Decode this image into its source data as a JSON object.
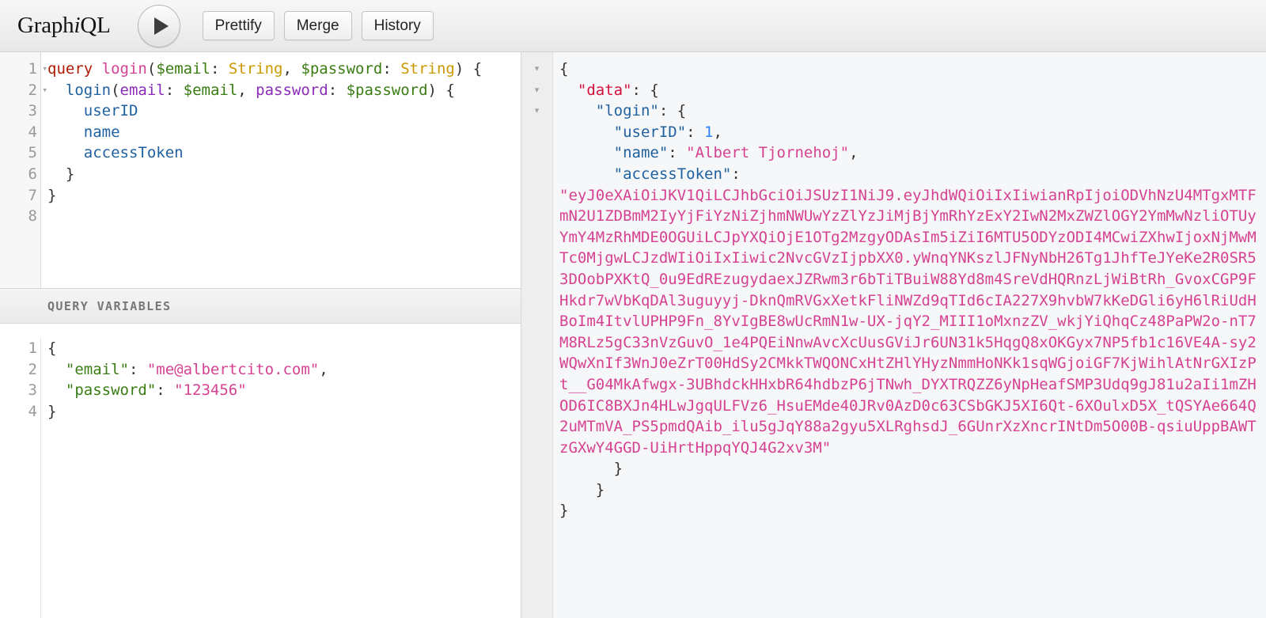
{
  "app": {
    "name": "GraphiQL",
    "name_prefix": "Graph",
    "name_italic": "i",
    "name_suffix": "QL"
  },
  "toolbar": {
    "execute_label": "▶",
    "execute_icon": "play-icon",
    "prettify_label": "Prettify",
    "merge_label": "Merge",
    "history_label": "History"
  },
  "query_editor": {
    "line_numbers": [
      "1",
      "2",
      "3",
      "4",
      "5",
      "6",
      "7",
      "8"
    ],
    "folds": [
      true,
      true,
      false,
      false,
      false,
      false,
      false,
      false
    ],
    "lines": [
      [
        {
          "text": "query",
          "type": "keyword"
        },
        {
          "text": " ",
          "type": "plain"
        },
        {
          "text": "login",
          "type": "def"
        },
        {
          "text": "(",
          "type": "punct"
        },
        {
          "text": "$email",
          "type": "variable"
        },
        {
          "text": ": ",
          "type": "punct"
        },
        {
          "text": "String",
          "type": "type"
        },
        {
          "text": ", ",
          "type": "punct"
        },
        {
          "text": "$password",
          "type": "variable"
        },
        {
          "text": ": ",
          "type": "punct"
        },
        {
          "text": "String",
          "type": "type"
        },
        {
          "text": ") {",
          "type": "punct"
        }
      ],
      [
        {
          "text": "  ",
          "type": "plain"
        },
        {
          "text": "login",
          "type": "qname"
        },
        {
          "text": "(",
          "type": "punct"
        },
        {
          "text": "email",
          "type": "attr"
        },
        {
          "text": ": ",
          "type": "punct"
        },
        {
          "text": "$email",
          "type": "variable"
        },
        {
          "text": ", ",
          "type": "punct"
        },
        {
          "text": "password",
          "type": "attr"
        },
        {
          "text": ": ",
          "type": "punct"
        },
        {
          "text": "$password",
          "type": "variable"
        },
        {
          "text": ") {",
          "type": "punct"
        }
      ],
      [
        {
          "text": "    ",
          "type": "plain"
        },
        {
          "text": "userID",
          "type": "property"
        }
      ],
      [
        {
          "text": "    ",
          "type": "plain"
        },
        {
          "text": "name",
          "type": "property"
        }
      ],
      [
        {
          "text": "    ",
          "type": "plain"
        },
        {
          "text": "accessToken",
          "type": "property"
        }
      ],
      [
        {
          "text": "  }",
          "type": "punct"
        }
      ],
      [
        {
          "text": "}",
          "type": "punct"
        }
      ],
      [
        {
          "text": "",
          "type": "plain"
        }
      ]
    ]
  },
  "variables_panel": {
    "header_label": "QUERY VARIABLES",
    "line_numbers": [
      "1",
      "2",
      "3",
      "4"
    ],
    "lines": [
      [
        {
          "text": "{",
          "type": "punct"
        }
      ],
      [
        {
          "text": "  ",
          "type": "plain"
        },
        {
          "text": "\"email\"",
          "type": "variable"
        },
        {
          "text": ": ",
          "type": "punct"
        },
        {
          "text": "\"me@albertcito.com\"",
          "type": "string"
        },
        {
          "text": ",",
          "type": "punct"
        }
      ],
      [
        {
          "text": "  ",
          "type": "plain"
        },
        {
          "text": "\"password\"",
          "type": "variable"
        },
        {
          "text": ": ",
          "type": "punct"
        },
        {
          "text": "\"123456\"",
          "type": "string"
        }
      ],
      [
        {
          "text": "}",
          "type": "punct"
        }
      ]
    ]
  },
  "result_panel": {
    "fold_arrows": [
      "▾",
      "▾",
      "▾"
    ],
    "lines": [
      [
        {
          "text": "{",
          "type": "punct"
        }
      ],
      [
        {
          "text": "  ",
          "type": "plain"
        },
        {
          "text": "\"data\"",
          "type": "datakey"
        },
        {
          "text": ": {",
          "type": "punct"
        }
      ],
      [
        {
          "text": "    ",
          "type": "plain"
        },
        {
          "text": "\"login\"",
          "type": "jsonkey"
        },
        {
          "text": ": {",
          "type": "punct"
        }
      ],
      [
        {
          "text": "      ",
          "type": "plain"
        },
        {
          "text": "\"userID\"",
          "type": "jsonkey"
        },
        {
          "text": ": ",
          "type": "punct"
        },
        {
          "text": "1",
          "type": "number"
        },
        {
          "text": ",",
          "type": "punct"
        }
      ],
      [
        {
          "text": "      ",
          "type": "plain"
        },
        {
          "text": "\"name\"",
          "type": "jsonkey"
        },
        {
          "text": ": ",
          "type": "punct"
        },
        {
          "text": "\"Albert Tjornehoj\"",
          "type": "string"
        },
        {
          "text": ",",
          "type": "punct"
        }
      ],
      [
        {
          "text": "      ",
          "type": "plain"
        },
        {
          "text": "\"accessToken\"",
          "type": "jsonkey"
        },
        {
          "text": ":",
          "type": "punct"
        }
      ]
    ],
    "access_token_value": "\"eyJ0eXAiOiJKV1QiLCJhbGciOiJSUzI1NiJ9.eyJhdWQiOiIxIiwianRpIjoiODVhNzU4MTgxMTFmN2U1ZDBmM2IyYjFiYzNiZjhmNWUwYzZlYzJiMjBjYmRhYzExY2IwN2MxZWZlOGY2YmMwNzliOTUyYmY4MzRhMDE0OGUiLCJpYXQiOjE1OTg2MzgyODAsIm5iZiI6MTU5ODYzODI4MCwiZXhwIjoxNjMwMTc0MjgwLCJzdWIiOiIxIiwic2NvcGVzIjpbXX0.yWnqYNKszlJFNyNbH26Tg1JhfTeJYeKe2R0SR53DOobPXKtQ_0u9EdREzugydaexJZRwm3r6bTiTBuiW88Yd8m4SreVdHQRnzLjWiBtRh_GvoxCGP9FHkdr7wVbKqDAl3uguyyj-DknQmRVGxXetkFliNWZd9qTId6cIA227X9hvbW7kKeDGli6yH6lRiUdHBoIm4ItvlUPHP9Fn_8YvIgBE8wUcRmN1w-UX-jqY2_MIII1oMxnzZV_wkjYiQhqCz48PaPW2o-nT7M8RLz5gC33nVzGuvO_1e4PQEiNnwAvcXcUusGViJr6UN31k5HqgQ8xOKGyx7NP5fb1c16VE4A-sy2WQwXnIf3WnJ0eZrT00HdSy2CMkkTWQONCxHtZHlYHyzNmmHoNKk1sqWGjoiGF7KjWihlAtNrGXIzPt__G04MkAfwgx-3UBhdckHHxbR64hdbzP6jTNwh_DYXTRQZZ6yNpHeafSMP3Udq9gJ81u2aIi1mZHOD6IC8BXJn4HLwJgqULFVz6_HsuEMde40JRv0AzD0c63CSbGKJ5XI6Qt-6XOulxD5X_tQSYAe664Q2uMTmVA_PS5pmdQAib_ilu5gJqY88a2gyu5XLRghsdJ_6GUnrXzXncrINtDm5O00B-qsiuUppBAWTzGXwY4GGD-UiHrtHppqYQJ4G2xv3M\"",
    "closing_lines": [
      [
        {
          "text": "      }",
          "type": "punct"
        }
      ],
      [
        {
          "text": "    }",
          "type": "punct"
        }
      ],
      [
        {
          "text": "}",
          "type": "punct"
        }
      ]
    ]
  }
}
